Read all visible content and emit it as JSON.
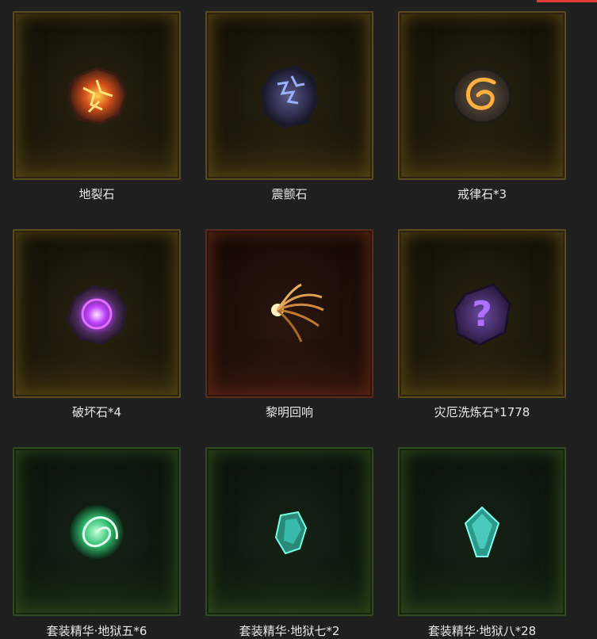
{
  "items": [
    {
      "label": "地裂石",
      "icon": "earth-rift-stone-icon",
      "rarity": "legendary",
      "accent": "#d45a1a"
    },
    {
      "label": "震颤石",
      "icon": "tremor-stone-icon",
      "rarity": "legendary",
      "accent": "#5b6bff"
    },
    {
      "label": "戒律石*3",
      "icon": "discipline-stone-icon",
      "rarity": "legendary",
      "accent": "#f0a030"
    },
    {
      "label": "破坏石*4",
      "icon": "destruction-stone-icon",
      "rarity": "legendary",
      "accent": "#c040ff"
    },
    {
      "label": "黎明回响",
      "icon": "dawn-echo-icon",
      "rarity": "set-red",
      "accent": "#e0a050"
    },
    {
      "label": "灾厄洗炼石*1778",
      "icon": "calamity-reforge-stone-icon",
      "rarity": "legendary",
      "accent": "#8a40ff"
    },
    {
      "label": "套装精华·地狱五*6",
      "icon": "set-essence-vortex-icon",
      "rarity": "set",
      "accent": "#40e0a0"
    },
    {
      "label": "套装精华·地狱七*2",
      "icon": "set-essence-crystal-icon",
      "rarity": "set",
      "accent": "#40d0c0"
    },
    {
      "label": "套装精华·地狱八*28",
      "icon": "set-essence-shard-icon",
      "rarity": "set",
      "accent": "#40d0c0"
    }
  ]
}
